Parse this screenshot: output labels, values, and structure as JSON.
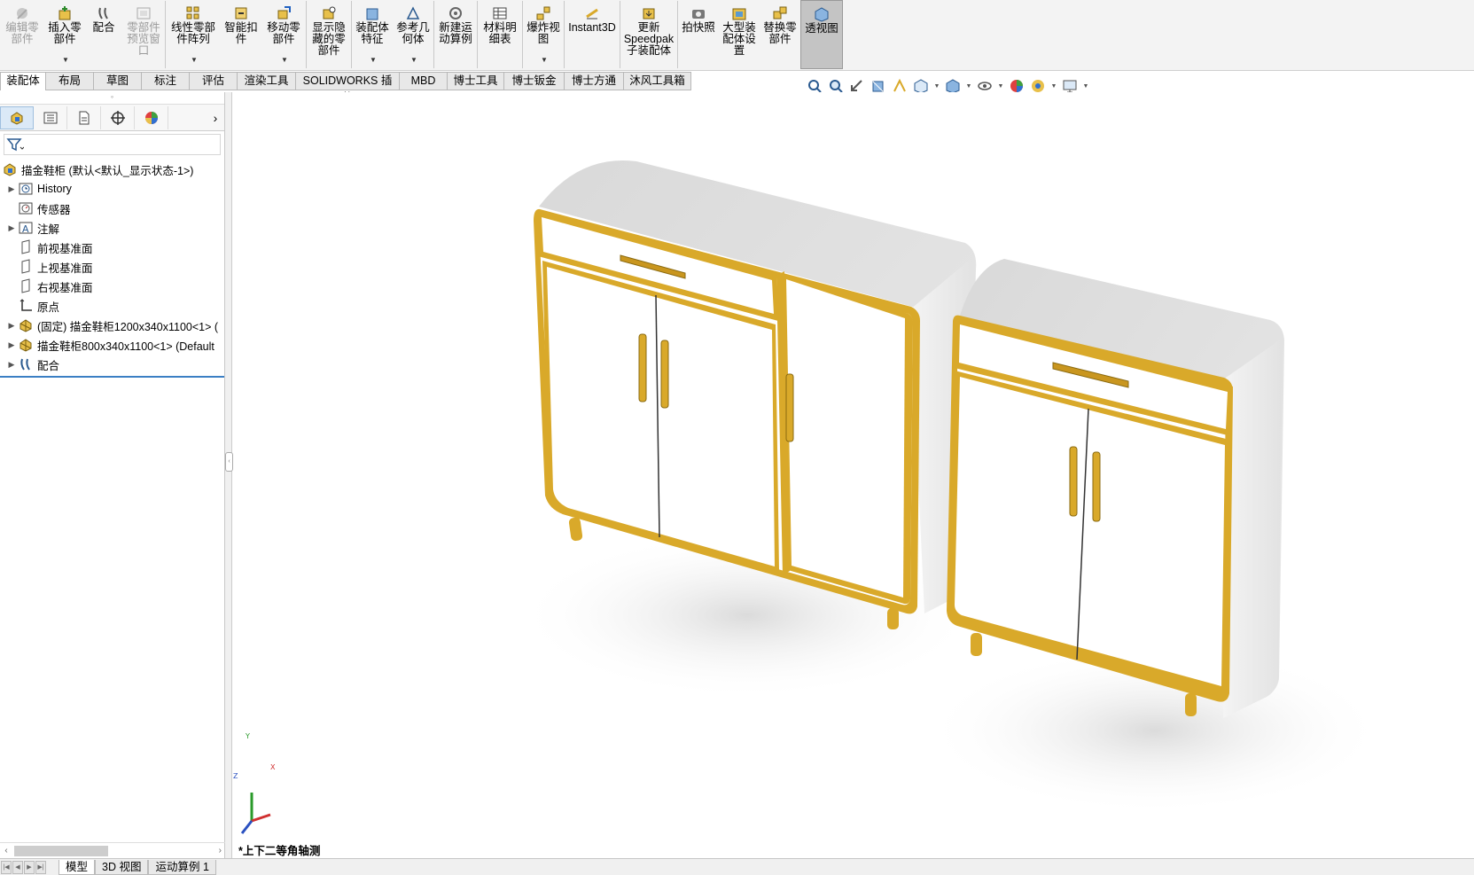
{
  "ribbon": {
    "buttons": [
      {
        "id": "edit-component",
        "label": "编辑零\n部件",
        "icon": "edit-component-icon",
        "disabled": true
      },
      {
        "id": "insert-component",
        "label": "插入零\n部件",
        "icon": "insert-component-icon",
        "dropdown": true
      },
      {
        "id": "mate",
        "label": "配合",
        "icon": "mate-icon"
      },
      {
        "id": "component-preview",
        "label": "零部件\n预览窗\n口",
        "icon": "preview-window-icon",
        "disabled": true
      },
      {
        "id": "linear-pattern",
        "label": "线性零部\n件阵列",
        "icon": "linear-pattern-icon",
        "dropdown": true
      },
      {
        "id": "smart-fasteners",
        "label": "智能扣\n件",
        "icon": "smart-fastener-icon"
      },
      {
        "id": "move-component",
        "label": "移动零\n部件",
        "icon": "move-component-icon",
        "dropdown": true
      },
      {
        "id": "show-hidden",
        "label": "显示隐\n藏的零\n部件",
        "icon": "show-hidden-icon"
      },
      {
        "id": "assembly-features",
        "label": "装配体\n特征",
        "icon": "assembly-feature-icon",
        "dropdown": true
      },
      {
        "id": "reference-geometry",
        "label": "参考几\n何体",
        "icon": "reference-geometry-icon",
        "dropdown": true
      },
      {
        "id": "new-motion-study",
        "label": "新建运\n动算例",
        "icon": "motion-study-icon"
      },
      {
        "id": "bom",
        "label": "材料明\n细表",
        "icon": "bom-icon"
      },
      {
        "id": "exploded-view",
        "label": "爆炸视\n图",
        "icon": "exploded-view-icon",
        "dropdown": true
      },
      {
        "id": "instant3d",
        "label": "Instant3D",
        "icon": "instant3d-icon"
      },
      {
        "id": "update-speedpak",
        "label": "更新\nSpeedpak\n子装配体",
        "icon": "speedpak-icon"
      },
      {
        "id": "snapshot",
        "label": "拍快照",
        "icon": "camera-icon"
      },
      {
        "id": "large-assembly",
        "label": "大型装\n配体设\n置",
        "icon": "large-assembly-icon"
      },
      {
        "id": "replace-components",
        "label": "替换零\n部件",
        "icon": "replace-component-icon"
      },
      {
        "id": "transparent-view",
        "label": "透视图",
        "icon": "transparent-view-icon",
        "active": true
      }
    ]
  },
  "tabs": [
    "装配体",
    "布局",
    "草图",
    "标注",
    "评估",
    "渲染工具",
    "SOLIDWORKS 插件",
    "MBD",
    "博士工具",
    "博士钣金",
    "博士方通",
    "沐风工具箱"
  ],
  "tree": {
    "root": "描金鞋柜 (默认<默认_显示状态-1>)",
    "items": [
      {
        "label": "History",
        "icon": "history-icon",
        "expandable": true
      },
      {
        "label": "传感器",
        "icon": "sensor-icon",
        "expandable": false
      },
      {
        "label": "注解",
        "icon": "annotation-icon",
        "expandable": true
      },
      {
        "label": "前视基准面",
        "icon": "plane-icon",
        "expandable": false
      },
      {
        "label": "上视基准面",
        "icon": "plane-icon",
        "expandable": false
      },
      {
        "label": "右视基准面",
        "icon": "plane-icon",
        "expandable": false
      },
      {
        "label": "原点",
        "icon": "origin-icon",
        "expandable": false
      },
      {
        "label": "(固定) 描金鞋柜1200x340x1100<1> (",
        "icon": "subassembly-icon",
        "expandable": true
      },
      {
        "label": "描金鞋柜800x340x1100<1> (Default",
        "icon": "subassembly-icon",
        "expandable": true
      },
      {
        "label": "配合",
        "icon": "mates-folder-icon",
        "expandable": true
      }
    ]
  },
  "view_label": "*上下二等角轴测",
  "triad": {
    "x": "X",
    "y": "Y",
    "z": "Z"
  },
  "bottom_tabs": [
    "模型",
    "3D 视图",
    "运动算例 1"
  ],
  "colors": {
    "gold": "#d9a92a",
    "ribbon_bg": "#f3f3f3",
    "active_btn": "#c4c4c4",
    "tree_selection_line": "#3b7fc4"
  }
}
